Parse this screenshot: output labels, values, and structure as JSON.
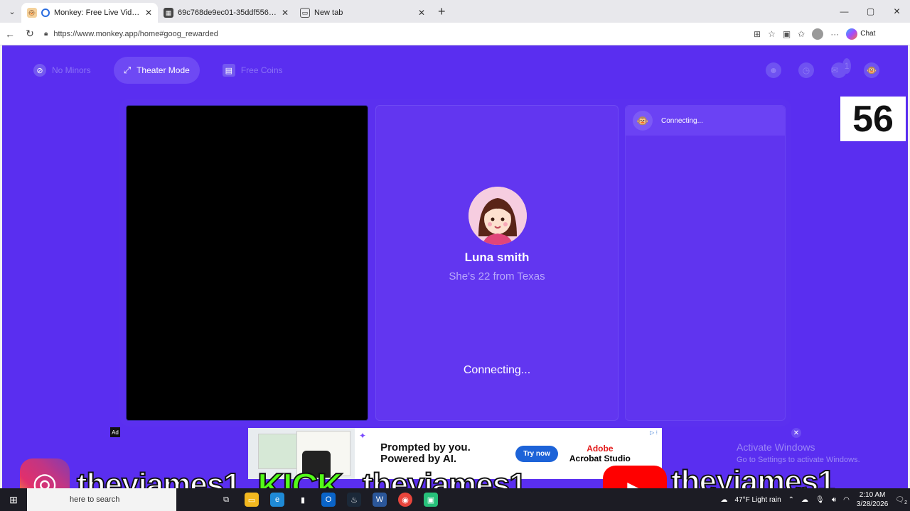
{
  "browser": {
    "tabs": [
      {
        "label": "Monkey: Free Live Video Chat",
        "active": true
      },
      {
        "label": "69c768de9ec01-35ddf5566c274f5c",
        "active": false
      },
      {
        "label": "New tab",
        "active": false
      }
    ],
    "url": "https://www.monkey.app/home#goog_rewarded",
    "chat_label": "Chat",
    "new_tab_glyph": "+"
  },
  "nav": {
    "no_minors": "No Minors",
    "theater_mode": "Theater Mode",
    "free_coins": "Free Coins",
    "message_badge": "1"
  },
  "peer": {
    "name": "Luna smith",
    "info": "She's 22 from Texas",
    "status": "Connecting..."
  },
  "chat": {
    "status": "Connecting..."
  },
  "counter": "56",
  "ad": {
    "label": "Ad",
    "headline": "Prompted by you. Powered by AI.",
    "button": "Try now",
    "brand_line1": "Adobe",
    "brand_line2": "Acrobat Studio"
  },
  "activate": {
    "title": "Activate Windows",
    "subtitle": "Go to Settings to activate Windows."
  },
  "overlay": {
    "handle1": "theyjames1",
    "kick": "KICK",
    "handle2": "theyjames1",
    "handle3": "theyjames1"
  },
  "taskbar": {
    "search_text": "here to search",
    "weather": "47°F  Light rain",
    "time": "2:10 AM",
    "date": "3/28/2026",
    "notification_count": "2"
  },
  "colors": {
    "page_bg": "#5a2ef0",
    "accent": "#6e49f4",
    "kick_green": "#53fc18",
    "youtube_red": "#ff0000"
  }
}
